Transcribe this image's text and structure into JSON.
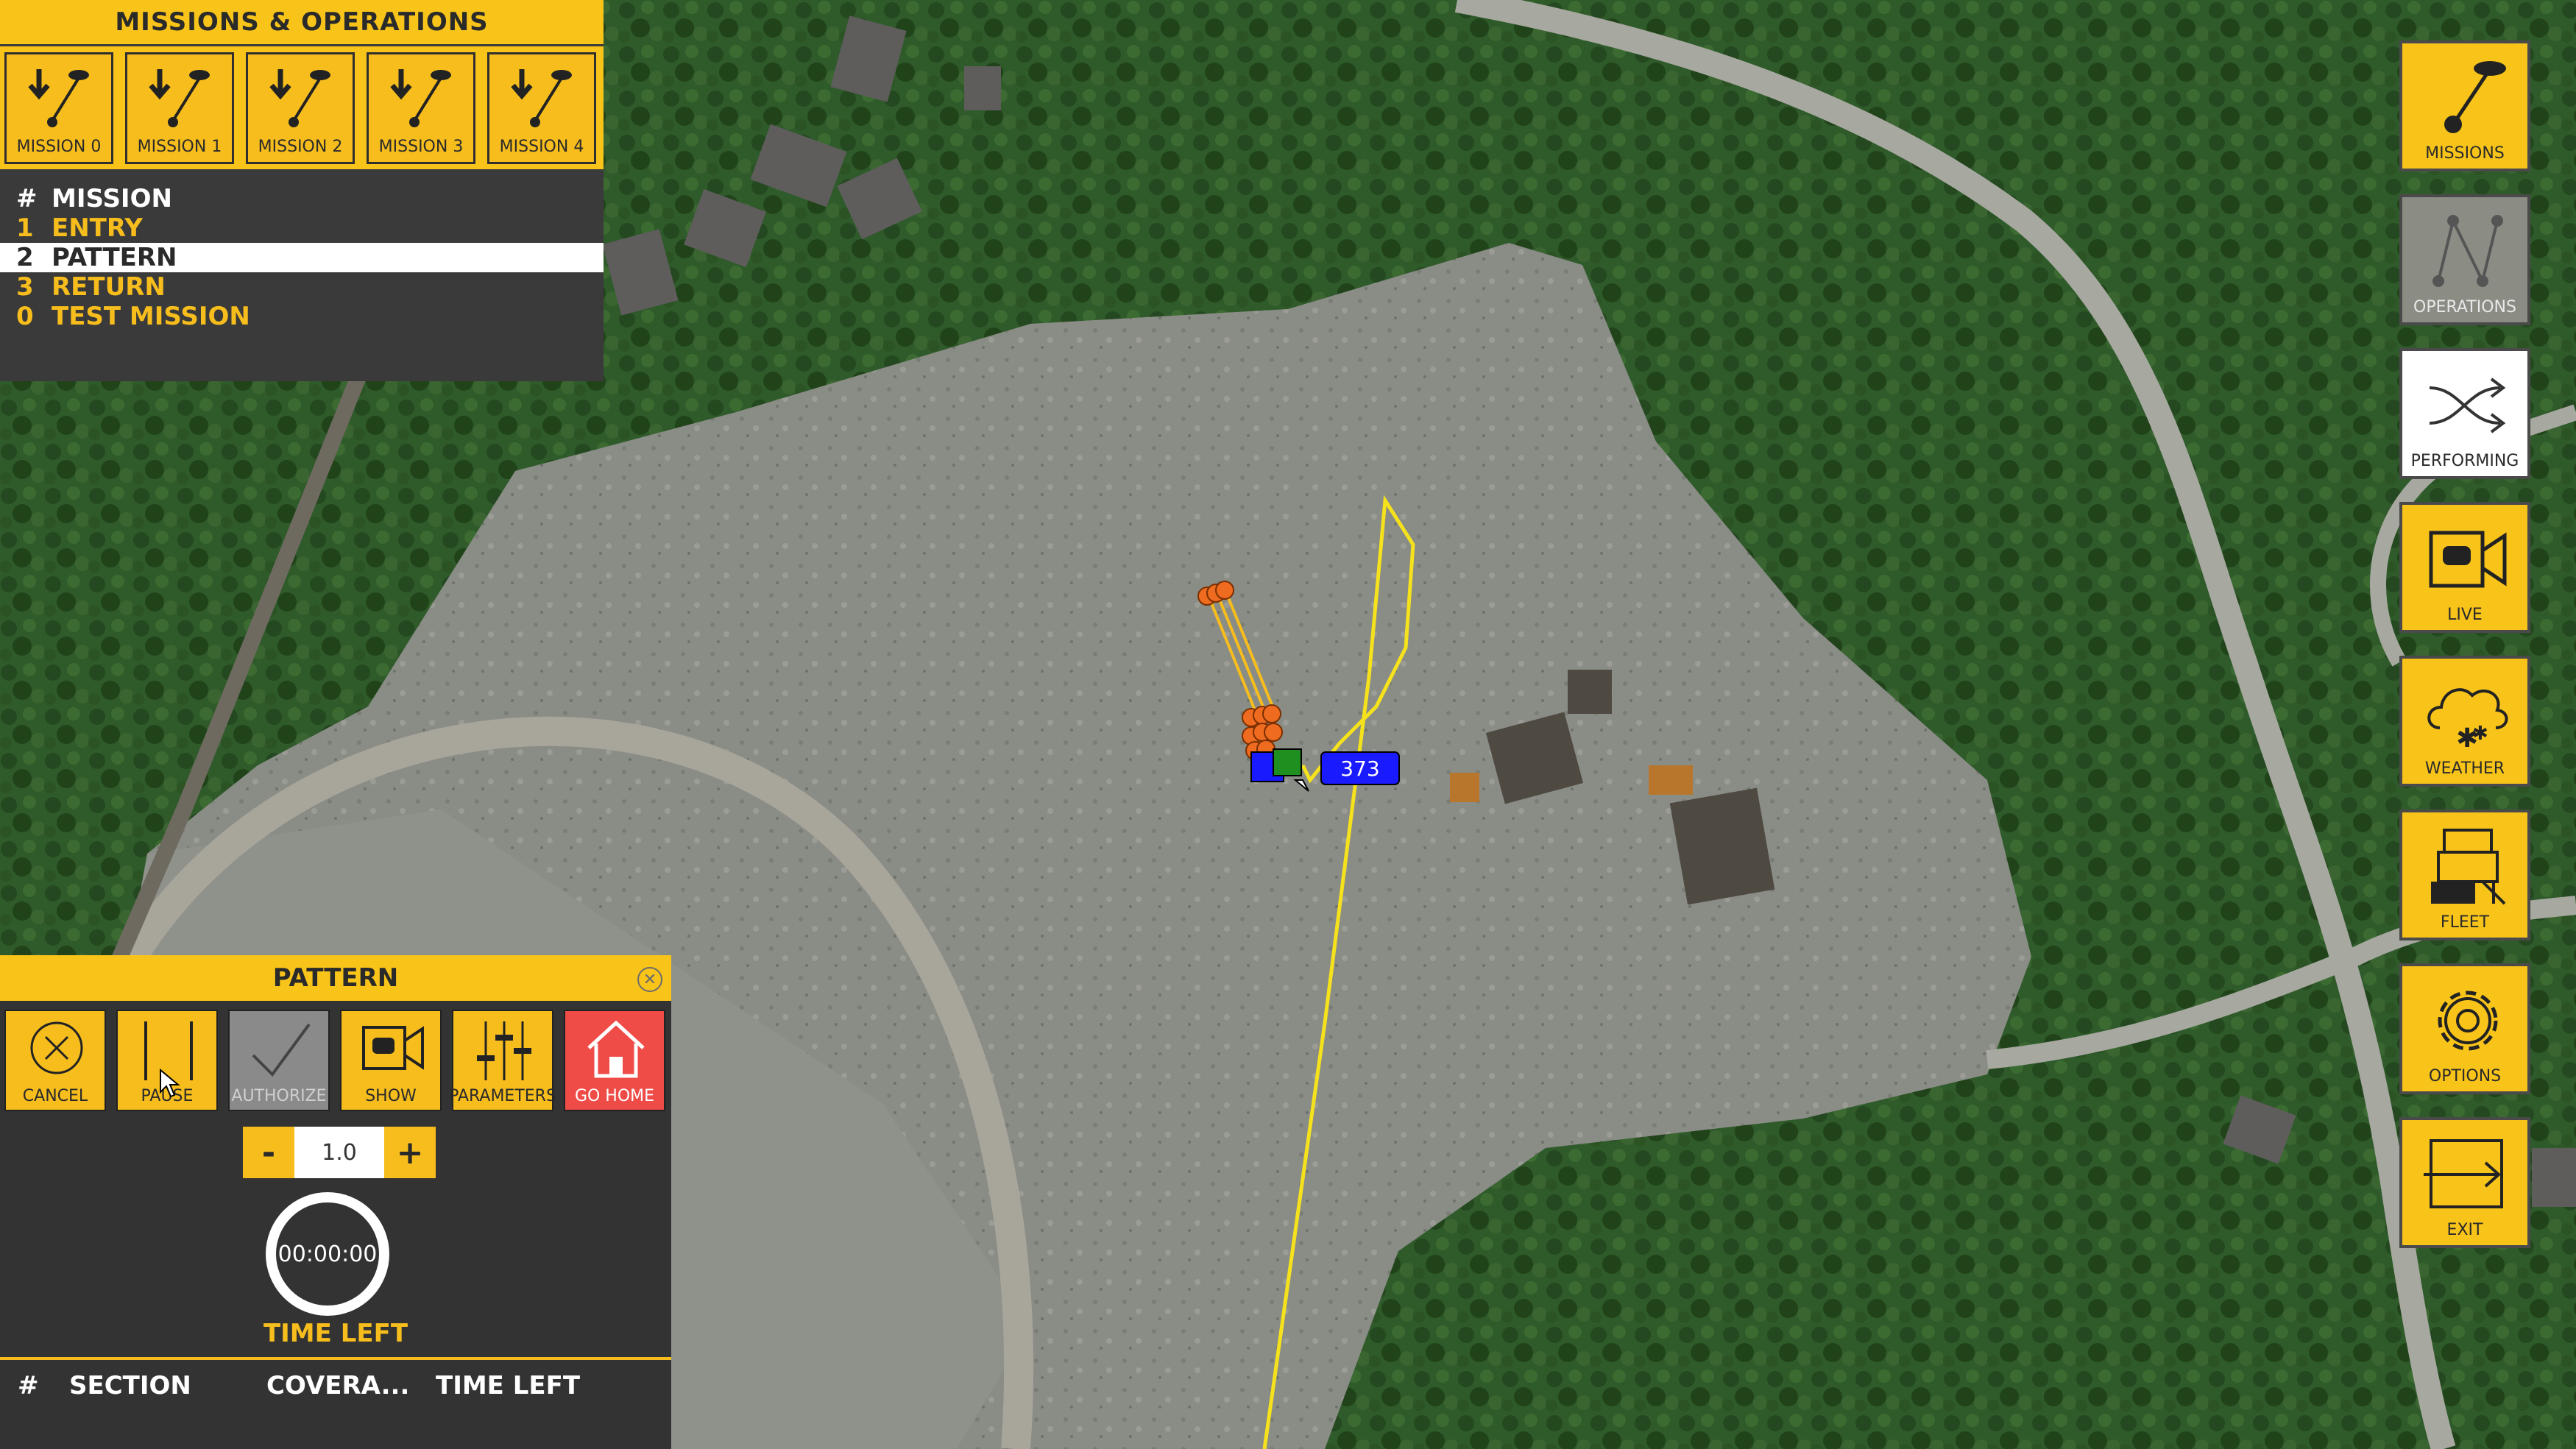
{
  "missions_panel": {
    "title": "MISSIONS & OPERATIONS",
    "mission_buttons": [
      "MISSION 0",
      "MISSION 1",
      "MISSION 2",
      "MISSION 3",
      "MISSION 4"
    ],
    "table_header": {
      "num": "#",
      "name": "MISSION"
    },
    "rows": [
      {
        "num": "1",
        "name": "ENTRY",
        "selected": false
      },
      {
        "num": "2",
        "name": "PATTERN",
        "selected": true
      },
      {
        "num": "3",
        "name": "RETURN",
        "selected": false
      },
      {
        "num": "0",
        "name": "TEST MISSION",
        "selected": false
      }
    ]
  },
  "rail": [
    {
      "label": "MISSIONS",
      "icon": "mission-path-icon",
      "state": "active"
    },
    {
      "label": "OPERATIONS",
      "icon": "operations-path-icon",
      "state": "disabled"
    },
    {
      "label": "PERFORMING",
      "icon": "shuffle-icon",
      "state": "selected"
    },
    {
      "label": "LIVE",
      "icon": "video-camera-icon",
      "state": "active"
    },
    {
      "label": "WEATHER",
      "icon": "cloud-snow-icon",
      "state": "active"
    },
    {
      "label": "FLEET",
      "icon": "fleet-icon",
      "state": "active"
    },
    {
      "label": "OPTIONS",
      "icon": "gear-icon",
      "state": "active"
    },
    {
      "label": "EXIT",
      "icon": "exit-icon",
      "state": "active"
    }
  ],
  "pattern_panel": {
    "title": "PATTERN",
    "tools": [
      {
        "label": "CANCEL",
        "icon": "cancel-circle-icon",
        "state": "active"
      },
      {
        "label": "PAUSE",
        "icon": "pause-icon",
        "state": "active"
      },
      {
        "label": "AUTHORIZE",
        "icon": "checkmark-icon",
        "state": "disabled"
      },
      {
        "label": "SHOW",
        "icon": "video-camera-icon",
        "state": "active"
      },
      {
        "label": "PARAMETERS",
        "icon": "sliders-icon",
        "state": "active"
      },
      {
        "label": "GO HOME",
        "icon": "home-icon",
        "state": "alert"
      }
    ],
    "stepper": {
      "minus": "-",
      "value": "1.0",
      "plus": "+"
    },
    "timer": "00:00:00",
    "time_left_label": "TIME LEFT",
    "section_table_header": {
      "num": "#",
      "section": "SECTION",
      "coverage": "COVERA...",
      "time_left": "TIME LEFT"
    }
  },
  "map_overlay": {
    "drone_label": "373",
    "colors": {
      "route": "#f5e21c",
      "waypoint": "#ef6b1f",
      "drone": "#1a1aff",
      "home": "#1f8f1f"
    }
  }
}
